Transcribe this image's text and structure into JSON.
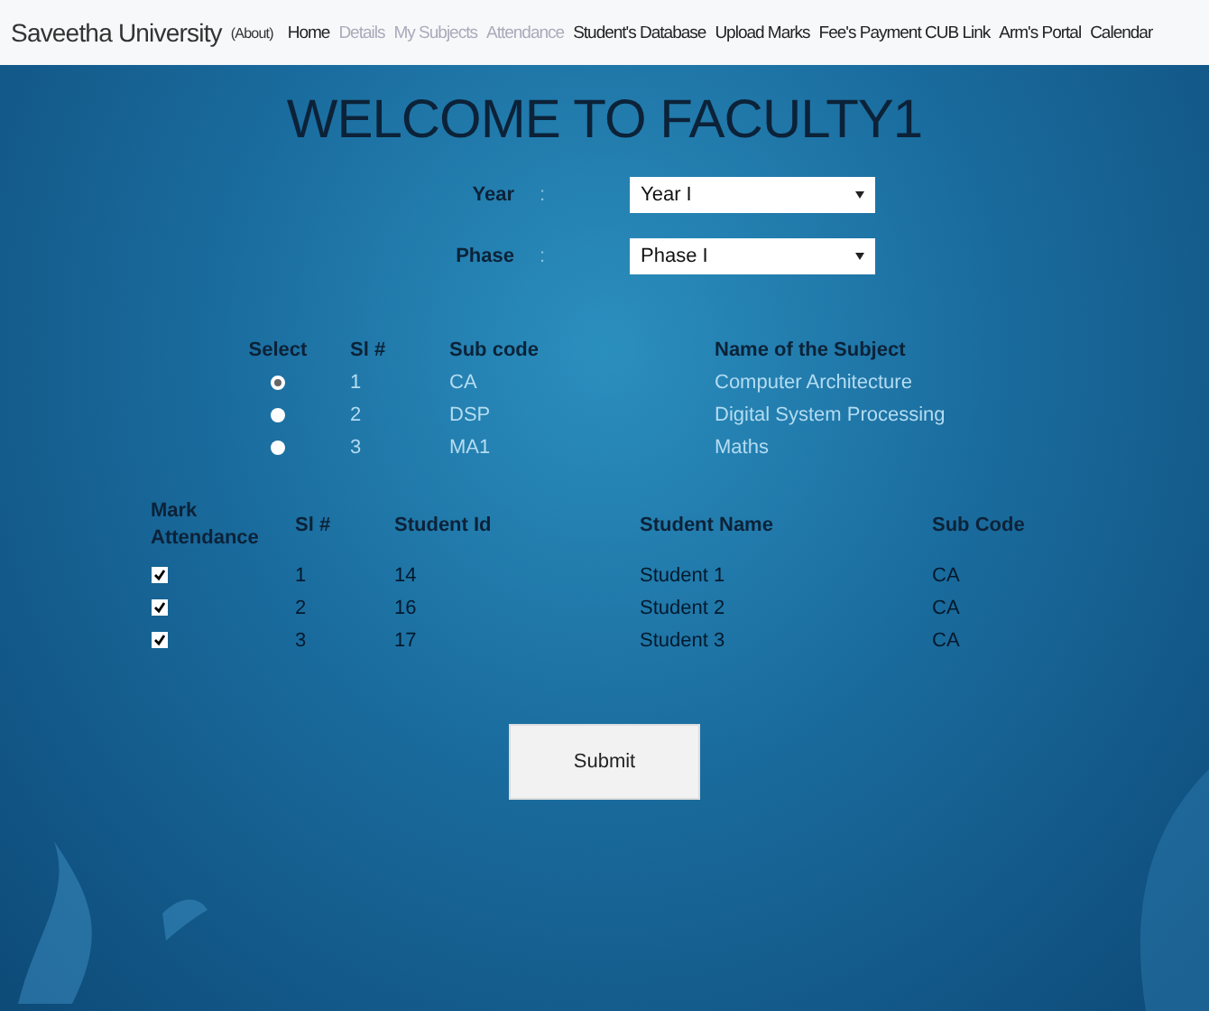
{
  "header": {
    "brand": "Saveetha University",
    "about": "(About)"
  },
  "nav": [
    {
      "label": "Home",
      "disabled": false
    },
    {
      "label": "Details",
      "disabled": true
    },
    {
      "label": "My Subjects",
      "disabled": true
    },
    {
      "label": "Attendance",
      "disabled": true
    },
    {
      "label": "Student's Database",
      "disabled": false
    },
    {
      "label": "Upload Marks",
      "disabled": false
    },
    {
      "label": "Fee's Payment CUB Link",
      "disabled": false
    },
    {
      "label": "Arm's Portal",
      "disabled": false
    },
    {
      "label": "Calendar",
      "disabled": false
    }
  ],
  "title": "WELCOME TO FACULTY1",
  "fields": [
    {
      "label": "Year",
      "separator": ":",
      "value": "Year I"
    },
    {
      "label": "Phase",
      "separator": ":",
      "value": "Phase I"
    }
  ],
  "subjects": {
    "columns": [
      "Select",
      "Sl #",
      "Sub code",
      "Name of the Subject"
    ],
    "rows": [
      {
        "selected": true,
        "sl": "1",
        "code": "CA",
        "name": "Computer Architecture"
      },
      {
        "selected": false,
        "sl": "2",
        "code": "DSP",
        "name": "Digital System Processing"
      },
      {
        "selected": false,
        "sl": "3",
        "code": "MA1",
        "name": "Maths"
      }
    ]
  },
  "students": {
    "columns": [
      "Mark Attendance",
      "Sl #",
      "Student Id",
      "Student Name",
      "Sub Code"
    ],
    "rows": [
      {
        "checked": true,
        "sl": "1",
        "id": "14",
        "name": "Student 1",
        "code": "CA"
      },
      {
        "checked": true,
        "sl": "2",
        "id": "16",
        "name": "Student 2",
        "code": "CA"
      },
      {
        "checked": true,
        "sl": "3",
        "id": "17",
        "name": "Student 3",
        "code": "CA"
      }
    ]
  },
  "submit": "Submit"
}
